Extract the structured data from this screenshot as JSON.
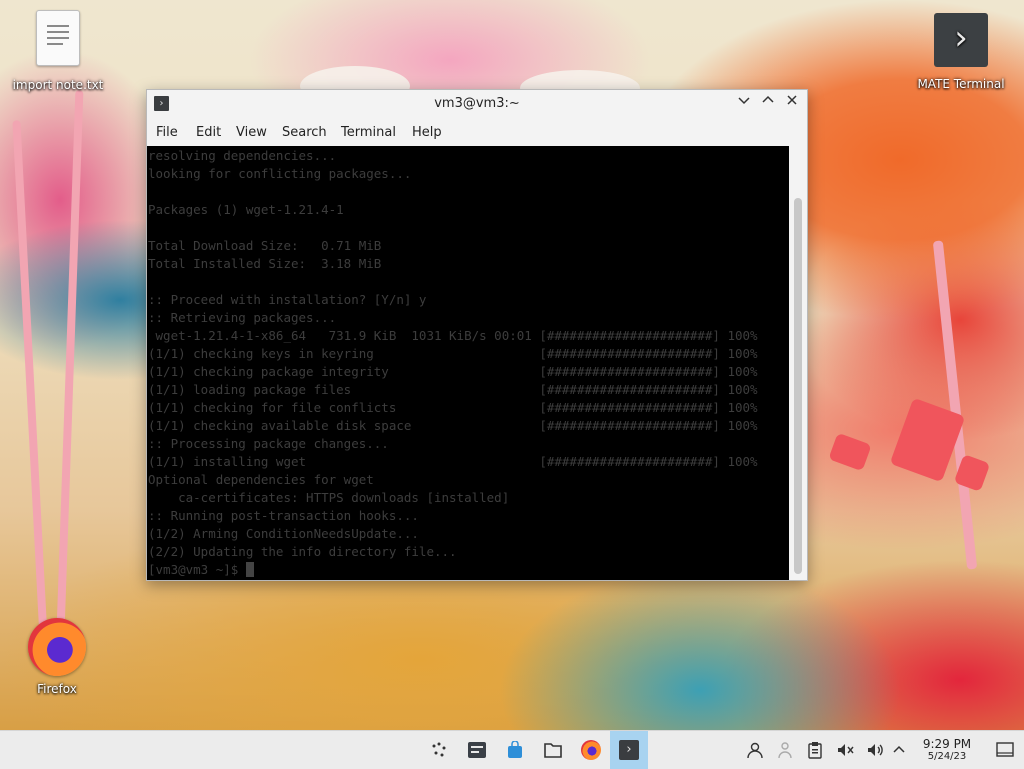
{
  "desktop": {
    "icons": [
      {
        "label": "import note.txt",
        "icon": "text-file-icon"
      },
      {
        "label": "MATE Terminal",
        "icon": "terminal-icon"
      },
      {
        "label": "Firefox",
        "icon": "firefox-icon"
      }
    ]
  },
  "window": {
    "title": "vm3@vm3:~",
    "menu": [
      "File",
      "Edit",
      "View",
      "Search",
      "Terminal",
      "Help"
    ],
    "terminal_lines": [
      "resolving dependencies...",
      "looking for conflicting packages...",
      "",
      "Packages (1) wget-1.21.4-1",
      "",
      "Total Download Size:   0.71 MiB",
      "Total Installed Size:  3.18 MiB",
      "",
      ":: Proceed with installation? [Y/n] y",
      ":: Retrieving packages...",
      " wget-1.21.4-1-x86_64   731.9 KiB  1031 KiB/s 00:01 [######################] 100%",
      "(1/1) checking keys in keyring                      [######################] 100%",
      "(1/1) checking package integrity                    [######################] 100%",
      "(1/1) loading package files                         [######################] 100%",
      "(1/1) checking for file conflicts                   [######################] 100%",
      "(1/1) checking available disk space                 [######################] 100%",
      ":: Processing package changes...",
      "(1/1) installing wget                               [######################] 100%",
      "Optional dependencies for wget",
      "    ca-certificates: HTTPS downloads [installed]",
      ":: Running post-transaction hooks...",
      "(1/2) Arming ConditionNeedsUpdate...",
      "(2/2) Updating the info directory file..."
    ],
    "prompt": "[vm3@vm3 ~]$ "
  },
  "taskbar": {
    "apps": [
      {
        "icon": "app-launcher-icon",
        "active": false
      },
      {
        "icon": "system-settings-icon",
        "active": false
      },
      {
        "icon": "software-store-icon",
        "active": false
      },
      {
        "icon": "file-manager-icon",
        "active": false
      },
      {
        "icon": "firefox-icon",
        "active": false
      },
      {
        "icon": "terminal-icon",
        "active": true
      }
    ],
    "tray": [
      "user-icon",
      "network-icon",
      "clipboard-icon",
      "mute-icon",
      "volume-icon",
      "chevron-up-icon"
    ],
    "clock_time": "9:29 PM",
    "clock_date": "5/24/23",
    "accent_color": "#a8d3f0"
  }
}
